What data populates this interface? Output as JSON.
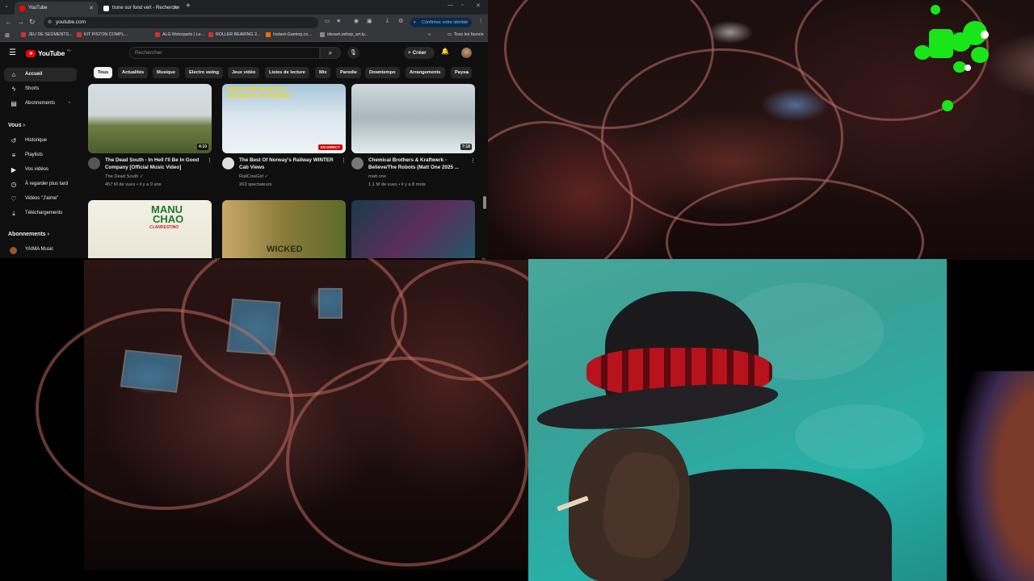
{
  "browser": {
    "tabs": [
      {
        "label": "YouTube",
        "favicon_color": "#ff0000",
        "active": true
      },
      {
        "label": "trone sur fond vert - Recherche",
        "favicon_color": "#ffffff",
        "active": false
      }
    ],
    "new_tab": "+",
    "address": "youtube.com",
    "confirm_identity": "Confirmer votre identité",
    "bookmarks": [
      {
        "label": "JEU DE SEGMENTS...",
        "favicon_color": "#d32f2f"
      },
      {
        "label": "KIT PISTON COMPL...",
        "favicon_color": "#d32f2f"
      },
      {
        "label": "ALG Motorparts | Le...",
        "favicon_color": "#d32f2f"
      },
      {
        "label": "ROLLER BEARING 2...",
        "favicon_color": "#d32f2f"
      },
      {
        "label": "Instant-Gaming.co...",
        "favicon_color": "#ff6a00"
      },
      {
        "label": "ideoart.sehep_art.ty...",
        "favicon_color": "#888888"
      }
    ],
    "all_bookmarks": "Tous les favoris"
  },
  "youtube": {
    "logo": "YouTube",
    "country": "FR",
    "search_placeholder": "Rechercher",
    "create_label": "Créer",
    "sidebar": {
      "items": [
        {
          "label": "Accueil",
          "icon": "home-icon",
          "glyph": "⌂"
        },
        {
          "label": "Shorts",
          "icon": "shorts-icon",
          "glyph": "⚡"
        },
        {
          "label": "Abonnements",
          "icon": "subscriptions-icon",
          "glyph": "▤"
        }
      ],
      "you_heading": "Vous",
      "you_items": [
        {
          "label": "Historique",
          "icon": "history-icon",
          "glyph": "↺"
        },
        {
          "label": "Playlists",
          "icon": "playlists-icon",
          "glyph": "≡"
        },
        {
          "label": "Vos vidéos",
          "icon": "your-videos-icon",
          "glyph": "▶"
        },
        {
          "label": "À regarder plus tard",
          "icon": "watch-later-icon",
          "glyph": "◷"
        },
        {
          "label": "Vidéos \"J'aime\"",
          "icon": "liked-icon",
          "glyph": "👍"
        },
        {
          "label": "Téléchargements",
          "icon": "downloads-icon",
          "glyph": "⤓"
        }
      ],
      "subs_heading": "Abonnements",
      "subs_items": [
        {
          "label": "YAIMA Music"
        }
      ]
    },
    "chips": [
      "Tous",
      "Actualités",
      "Musique",
      "Electro swing",
      "Jeux vidéo",
      "Listes de lecture",
      "Mix",
      "Parodie",
      "Downtempo",
      "Arrangements",
      "Paysa"
    ],
    "videos": [
      {
        "title": "The Dead South - In Hell I'll Be In Good Company [Official Music Video]",
        "channel": "The Dead South ✓",
        "meta": "457 M de vues • il y a 9 ans",
        "badge": "4:10",
        "live": false,
        "thumb": "linear-gradient(180deg,#d7dde0 0%,#cfd6d8 45%,#6d7f44 60%,#4c5a2c 100%)",
        "avatar_color": "#555555"
      },
      {
        "title": "The Best Of Norway's Railway WINTER Cab Views",
        "channel": "RailCowGirl ✓",
        "meta": "263 spectateurs",
        "badge": "EN DIRECT",
        "live": true,
        "thumb": "linear-gradient(180deg,#a8c6d8 0%,#d9e6ee 45%,#eef3f6 100%)",
        "avatar_color": "#e0e0e0"
      },
      {
        "title": "Chemical Brothers & Kraftwerk - Believe/The Robots (Matt One 2025 ...",
        "channel": "matt one",
        "meta": "1,1 M de vues • il y a 8 mois",
        "badge": "7:18",
        "live": false,
        "thumb": "linear-gradient(180deg,#cfd8dc 0%,#aab7bd 50%,#e6ecee 100%)",
        "avatar_color": "#777777"
      },
      {
        "thumb": "linear-gradient(180deg,#f3f0e6 0%,#e8e3d2 100%)"
      },
      {
        "thumb": "linear-gradient(90deg,#c9a86a 0%,#8a7a3a 50%,#5c6b2a 100%)"
      },
      {
        "thumb": "linear-gradient(135deg,#1b3a4a 0%,#5a2e5a 50%,#1d5b6b 100%)"
      }
    ],
    "thumb_text": {
      "norway": "FROM THE MAJESTIC RAILWAYS OF NORWAY",
      "manu_line1": "MANU",
      "manu_line2": "CHAO",
      "manu_line3": "CLANDESTINO",
      "wicked": "WICKED"
    }
  },
  "colors": {
    "accent_green": "#19e619",
    "yt_red": "#ff0000",
    "bg": "#0f0f0f"
  }
}
